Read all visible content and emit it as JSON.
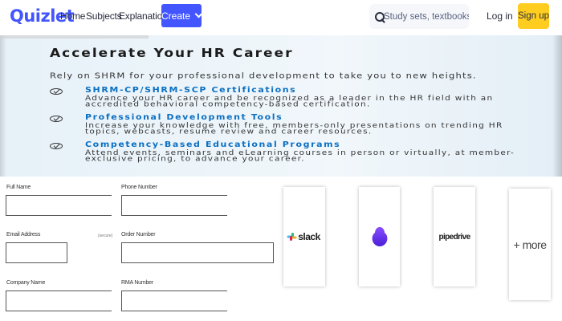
{
  "header": {
    "logo": "Quizlet",
    "nav": [
      "Home",
      "Subjects",
      "Explanations"
    ],
    "create_label": "Create",
    "search_placeholder": "Study sets, textbooks, ...",
    "login_label": "Log in",
    "signup_label": "Sign up",
    "colors": {
      "brand": "#4255ff",
      "signup": "#ffcd1f"
    }
  },
  "banner": {
    "title": "Accelerate Your HR Career",
    "subtitle": "Rely on SHRM for your professional development to take you to new heights.",
    "items": [
      {
        "title": "SHRM-CP/SHRM-SCP Certifications",
        "desc": "Advance your HR career and be recognized as a leader in the HR field with an accredited behavioral competency-based certification."
      },
      {
        "title": "Professional Development Tools",
        "desc": "Increase your knowledge with free, members-only presentations on trending HR topics, webcasts, resume review and career resources."
      },
      {
        "title": "Competency-Based Educational Programs",
        "desc": "Attend events, seminars and eLearning courses in person or virtually, at member-exclusive pricing, to advance your career."
      }
    ]
  },
  "form": {
    "full_name": "Full Name",
    "phone_number": "Phone Number",
    "email_address": "Email Address",
    "email_hint": "(secure)",
    "order_number": "Order Number",
    "company_name": "Company Name",
    "rma_number": "RMA Number"
  },
  "cards": {
    "slack": "slack",
    "pipedrive": "pipedrive",
    "more": "+ more"
  }
}
